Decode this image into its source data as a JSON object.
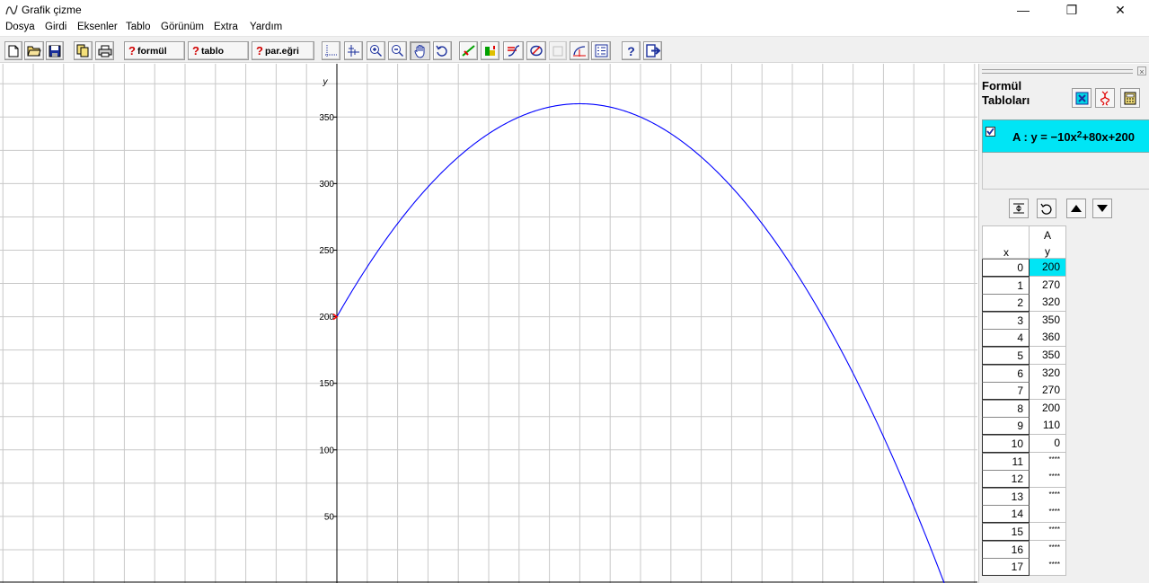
{
  "window": {
    "title": "Grafik çizme",
    "controls": {
      "minimize": "—",
      "maximize": "❐",
      "close": "✕"
    }
  },
  "menu": [
    "Dosya",
    "Girdi",
    "Eksenler",
    "Tablo",
    "Görünüm",
    "Extra",
    "Yardım"
  ],
  "toolbar": {
    "formula_button": "formül",
    "table_button": "tablo",
    "param_curve_button": "par.eğri",
    "help_button": "?",
    "icons": [
      "new-file-icon",
      "open-folder-icon",
      "save-icon",
      "copy-icon",
      "print-icon",
      "axes-dotted-icon",
      "axes-ticks-icon",
      "zoom-in-icon",
      "zoom-out-icon",
      "hand-pan-icon",
      "reset-view-icon",
      "pen-line-icon",
      "tangent-icon",
      "integral-icon",
      "eraser-icon",
      "grid-icon",
      "slope-icon",
      "list-icon",
      "exit-icon"
    ]
  },
  "graph": {
    "y_axis_label": "y",
    "y_ticks": [
      "350",
      "300",
      "250",
      "200",
      "150",
      "100",
      "50"
    ],
    "curve_color": "#0000ff",
    "marker_color": "#ff0000"
  },
  "chart_data": {
    "type": "line",
    "series": [
      {
        "formula": "y = -10x^2+80x+200",
        "x": [
          0,
          1,
          2,
          3,
          4,
          5,
          6,
          7,
          8,
          9,
          10
        ],
        "y": [
          200,
          270,
          320,
          350,
          360,
          350,
          320,
          270,
          200,
          110,
          0
        ]
      }
    ],
    "ylabel": "y",
    "ylim": [
      0,
      380
    ],
    "grid": true
  },
  "panel": {
    "title_line1": "Formül",
    "title_line2": "Tabloları",
    "formula_label_prefix": "A : y = −10x",
    "formula_exponent": "2",
    "formula_label_suffix": "+80x+200",
    "formula_checked": true,
    "accent_color": "#00e5f5"
  },
  "table": {
    "x_header": "x",
    "col_name": "A",
    "col_var": "y",
    "rows": [
      {
        "x": "0",
        "y": "200"
      },
      {
        "x": "1",
        "y": "270"
      },
      {
        "x": "2",
        "y": "320"
      },
      {
        "x": "3",
        "y": "350"
      },
      {
        "x": "4",
        "y": "360"
      },
      {
        "x": "5",
        "y": "350"
      },
      {
        "x": "6",
        "y": "320"
      },
      {
        "x": "7",
        "y": "270"
      },
      {
        "x": "8",
        "y": "200"
      },
      {
        "x": "9",
        "y": "110"
      },
      {
        "x": "10",
        "y": "0"
      },
      {
        "x": "11",
        "y": "****"
      },
      {
        "x": "12",
        "y": "****"
      },
      {
        "x": "13",
        "y": "****"
      },
      {
        "x": "14",
        "y": "****"
      },
      {
        "x": "15",
        "y": "****"
      },
      {
        "x": "16",
        "y": "****"
      },
      {
        "x": "17",
        "y": "****"
      }
    ]
  }
}
